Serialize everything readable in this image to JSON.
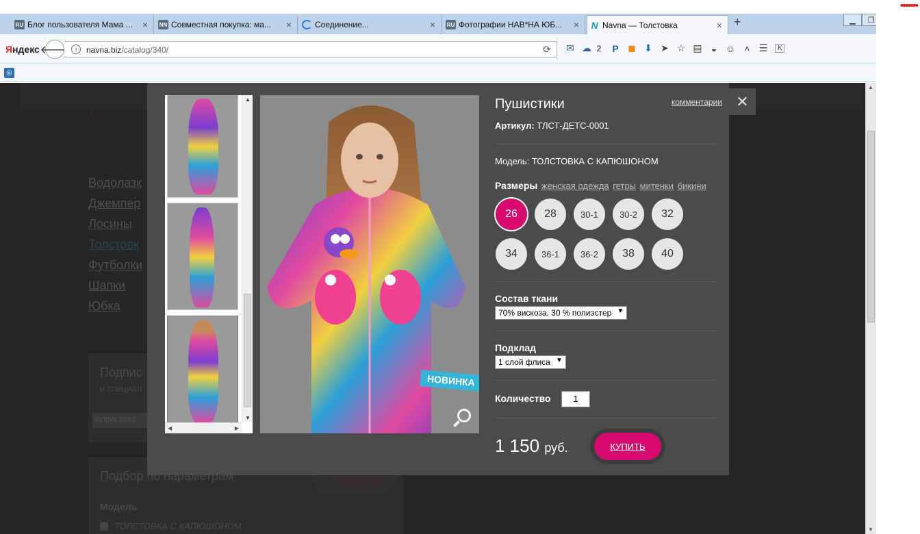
{
  "browser": {
    "tabs": [
      {
        "favicon": "RU",
        "title": "Блог пользователя Мама ..."
      },
      {
        "favicon": "NN",
        "title": "Совместная покупка: ма..."
      },
      {
        "favicon": "",
        "title": "Соединение..."
      },
      {
        "favicon": "RU",
        "title": "Фотографии НАВ*НА ЮБ..."
      },
      {
        "favicon": "N",
        "title": "Navna — Толстовка"
      }
    ],
    "new_tab": "+",
    "tab_close": "×",
    "yandex_logo_y": "Я",
    "yandex_logo_rest": "ндекс",
    "url_domain": "navna.biz",
    "url_path": "/catalog/340/",
    "weather_count": "2"
  },
  "page_bg": {
    "menu": [
      "Водолазк",
      "Джемпер",
      "Лосины",
      "Толстовк",
      "Футболки",
      "Шапки",
      "Юбка"
    ],
    "subscribe_title": "Подпис",
    "subscribe_sub": "и специал",
    "subscribe_input": "ionova.tatna",
    "filter_title": "Подбор по параметрам",
    "filter_model_label": "Модель",
    "filter_model_value": "ТОЛСТОВКА С КАПЮШОНОМ",
    "price_value": "1 150",
    "price_unit": "Руб"
  },
  "product": {
    "title": "Пушистики",
    "comments_link": "комментарии",
    "sku_label": "Артикул:",
    "sku_value": "ТЛСТ-ДЕТС-0001",
    "model_label": "Модель:",
    "model_value": "ТОЛСТОВКА С КАПЮШОНОМ",
    "sizes_label": "Размеры",
    "size_links": [
      "женская одежда",
      "гетры",
      "митенки",
      "бикини"
    ],
    "sizes": [
      "26",
      "28",
      "30-1",
      "30-2",
      "32",
      "34",
      "36-1",
      "36-2",
      "38",
      "40"
    ],
    "selected_size": "26",
    "fabric_label": "Состав ткани",
    "fabric_value": "70% вискоза, 30 % полиэстер",
    "lining_label": "Подклад",
    "lining_value": "1 слой флиса",
    "quantity_label": "Количество",
    "quantity_value": "1",
    "price": "1 150",
    "currency": "руб.",
    "buy_label": "КУПИТЬ",
    "badge": "НОВИНКА"
  },
  "colors": {
    "accent": "#d70a6d",
    "badge": "#35b4d8",
    "modal_bg": "#4b4b4b",
    "overlay": "#252525"
  }
}
